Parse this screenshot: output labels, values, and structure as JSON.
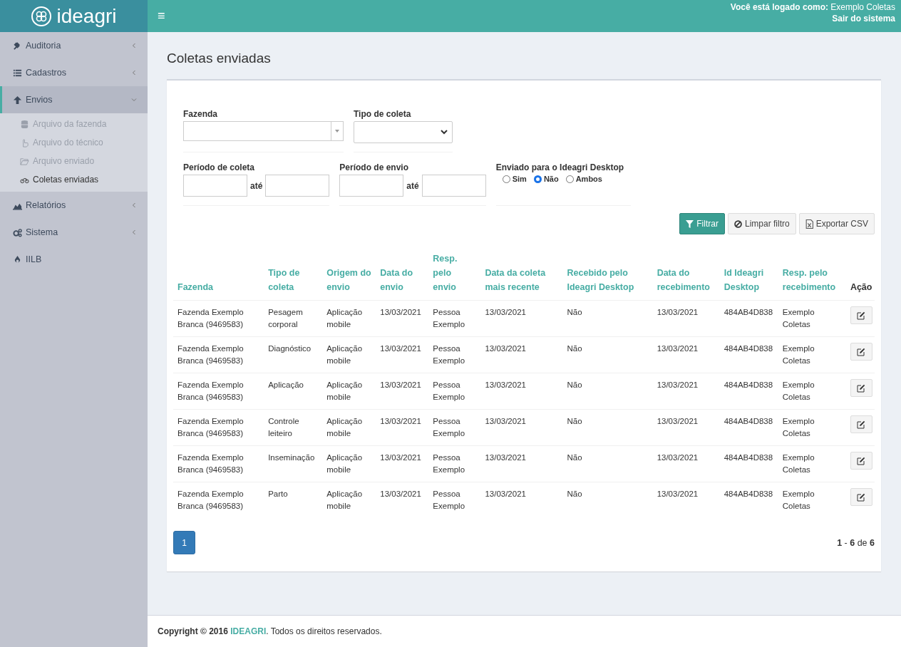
{
  "logo": {
    "text": "ideagri"
  },
  "header": {
    "menu_icon": "≡",
    "user": "**Você está logado como:** Exemplo Coletas",
    "logout": "Sair do sistema"
  },
  "sidebar": {
    "items": [
      {
        "label": "Auditoria",
        "expanded": false
      },
      {
        "label": "Cadastros",
        "expanded": false
      },
      {
        "label": "Envios",
        "expanded": true,
        "children": [
          {
            "label": "Arquivo da fazenda",
            "selected": false
          },
          {
            "label": "Arquivo do técnico",
            "selected": false
          },
          {
            "label": "Arquivo enviado",
            "selected": false
          },
          {
            "label": "Coletas enviadas",
            "selected": true
          }
        ]
      },
      {
        "label": "Relatórios",
        "expanded": false
      },
      {
        "label": "Sistema",
        "expanded": false
      },
      {
        "label": "IILB"
      }
    ]
  },
  "page_title": "Coletas enviadas",
  "filters": {
    "fazenda": {
      "label": "Fazenda"
    },
    "tipo": {
      "label": "Tipo de coleta"
    },
    "periodo_coleta": {
      "label": "Período de coleta",
      "between": "até"
    },
    "periodo_envio": {
      "label": "Período de envio",
      "between": "até"
    },
    "enviado": {
      "label": "Enviado para o Ideagri Desktop",
      "options": [
        {
          "label": "Sim",
          "selected": false
        },
        {
          "label": "Não",
          "selected": true
        },
        {
          "label": "Ambos",
          "selected": false
        }
      ]
    }
  },
  "buttons": [
    {
      "label": "Filtrar",
      "kind": "primary"
    },
    {
      "label": "Limpar filtro",
      "kind": "clear"
    },
    {
      "label": "Exportar CSV",
      "kind": "export"
    }
  ],
  "table": {
    "columns": [
      "Fazenda",
      "Tipo de coleta",
      "Origem do envio",
      "Data do envio",
      "Resp. pelo envio",
      "Data da coleta mais recente",
      "Recebido pelo Ideagri Desktop",
      "Data do recebimento",
      "Id Ideagri Desktop",
      "Resp. pelo recebimento",
      "Ação"
    ],
    "rows": [
      [
        "Fazenda Exemplo Branca (9469583)",
        "Pesagem corporal",
        "Aplicação mobile",
        "13/03/2021",
        "Pessoa Exemplo",
        "13/03/2021",
        "Não",
        "13/03/2021",
        "484AB4D838",
        "Exemplo Coletas"
      ],
      [
        "Fazenda Exemplo Branca (9469583)",
        "Diagnóstico",
        "Aplicação mobile",
        "13/03/2021",
        "Pessoa Exemplo",
        "13/03/2021",
        "Não",
        "13/03/2021",
        "484AB4D838",
        "Exemplo Coletas"
      ],
      [
        "Fazenda Exemplo Branca (9469583)",
        "Aplicação",
        "Aplicação mobile",
        "13/03/2021",
        "Pessoa Exemplo",
        "13/03/2021",
        "Não",
        "13/03/2021",
        "484AB4D838",
        "Exemplo Coletas"
      ],
      [
        "Fazenda Exemplo Branca (9469583)",
        "Controle leiteiro",
        "Aplicação mobile",
        "13/03/2021",
        "Pessoa Exemplo",
        "13/03/2021",
        "Não",
        "13/03/2021",
        "484AB4D838",
        "Exemplo Coletas"
      ],
      [
        "Fazenda Exemplo Branca (9469583)",
        "Inseminação",
        "Aplicação mobile",
        "13/03/2021",
        "Pessoa Exemplo",
        "13/03/2021",
        "Não",
        "13/03/2021",
        "484AB4D838",
        "Exemplo Coletas"
      ],
      [
        "Fazenda Exemplo Branca (9469583)",
        "Parto",
        "Aplicação mobile",
        "13/03/2021",
        "Pessoa Exemplo",
        "13/03/2021",
        "Não",
        "13/03/2021",
        "484AB4D838",
        "Exemplo Coletas"
      ]
    ]
  },
  "pagination": {
    "pages": [
      {
        "label": "1",
        "selected": true
      }
    ],
    "summary": "**1** - **6** de **6**"
  },
  "footer": {
    "prefix": "Copyright © 2016",
    "link": "IDEAGRI",
    "suffix": ". Todos os direitos reservados."
  }
}
